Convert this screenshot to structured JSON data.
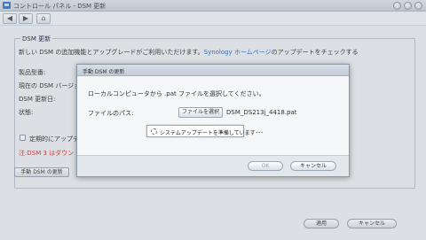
{
  "window": {
    "title": "コントロール パネル - DSM 更新"
  },
  "toolbar": {
    "back_icon": "arrow-left-icon",
    "forward_icon": "arrow-right-icon",
    "home_icon": "home-icon"
  },
  "section": {
    "legend": "DSM 更新",
    "intro_prefix": "新しい DSM の追加機能とアップグレードがご利用いただけます。",
    "intro_link": "Synology ホームページ",
    "intro_suffix": "のアップデートをチェックする",
    "field_model": "製品型番:",
    "field_current_version": "現在の DSM バージョ",
    "field_update_date": "DSM 更新日:",
    "field_status": "状態:",
    "checkbox_label": "定期的にアップデー",
    "warning": "注:DSM 3 はダウン",
    "manual_update_button": "手動 DSM の更新"
  },
  "dialog": {
    "title": "手動 DSM の更新",
    "instruction": "ローカルコンピュータから .pat ファイルを選択してください。",
    "file_path_label": "ファイルのパス:",
    "choose_file_button": "ファイルを選択",
    "file_name": "DSM_DS213j_4418.pat",
    "progress_text": "システムアップデートを準備しています･･･",
    "ok_button": "OK",
    "cancel_button": "キャンセル"
  },
  "footer": {
    "apply_button": "適用",
    "cancel_button": "キャンセル"
  }
}
